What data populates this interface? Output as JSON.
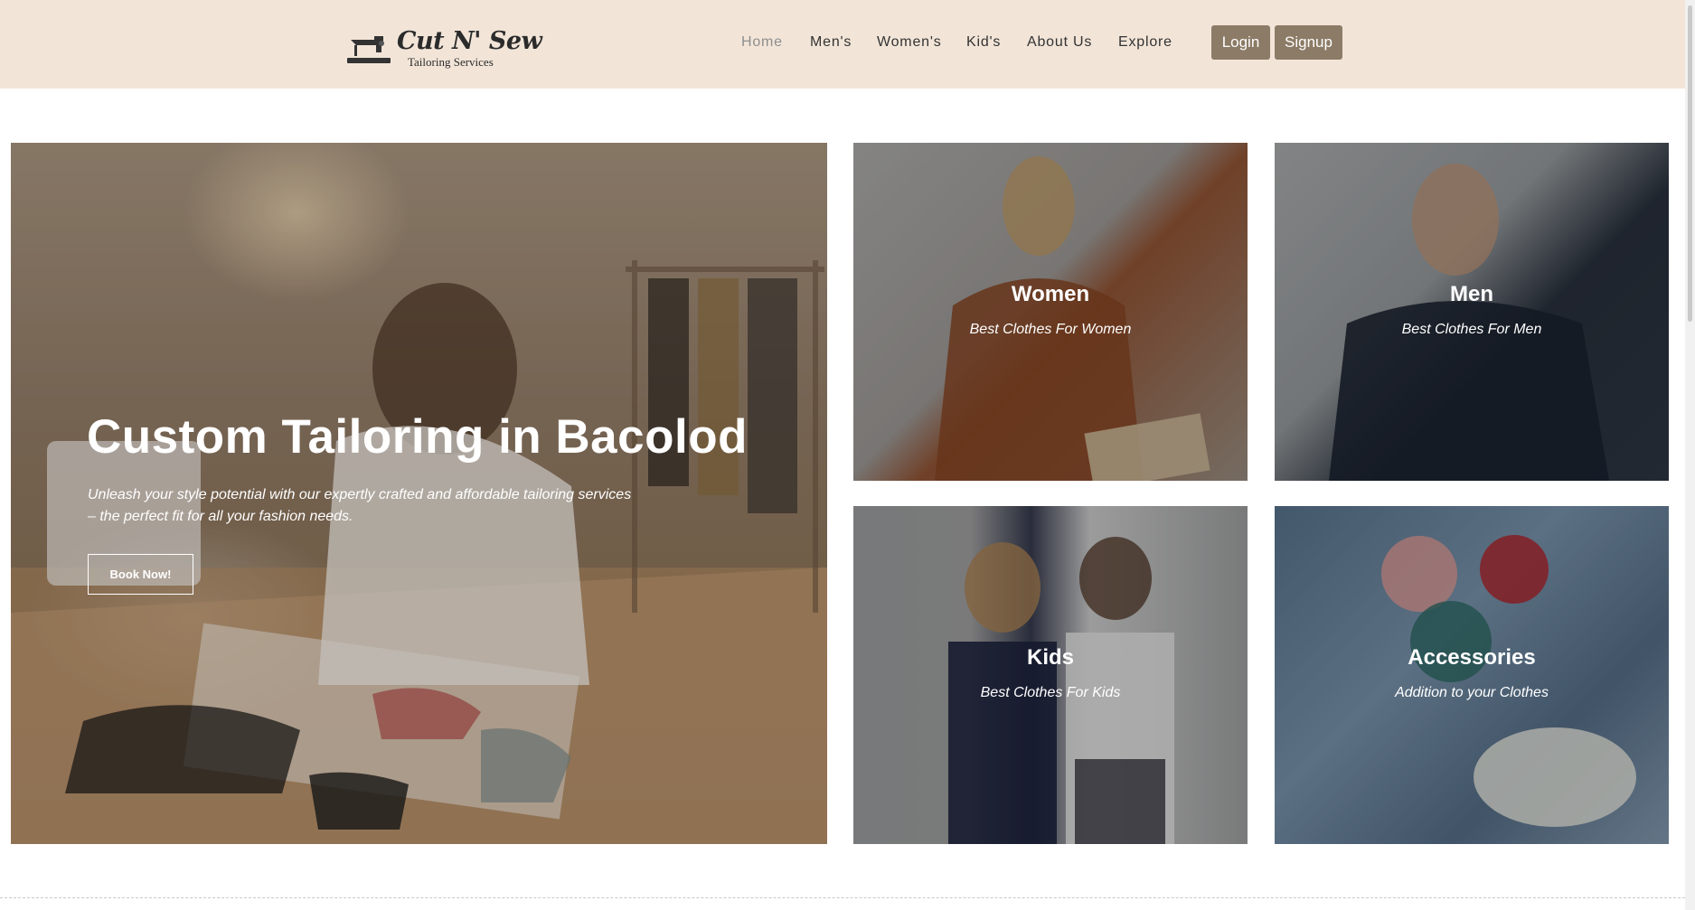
{
  "header": {
    "logo_title": "Cut N' Sew",
    "logo_subtitle": "Tailoring Services",
    "nav": [
      "Home",
      "Men's",
      "Women's",
      "Kid's",
      "About Us",
      "Explore"
    ],
    "active_nav": "Home",
    "login_label": "Login",
    "signup_label": "Signup"
  },
  "hero": {
    "title": "Custom Tailoring in Bacolod",
    "subtitle": "Unleash your style potential with our expertly crafted and affordable tailoring services – the perfect fit for all your fashion needs.",
    "button_label": "Book Now!"
  },
  "categories": [
    {
      "title": "Women",
      "subtitle": "Best Clothes For Women"
    },
    {
      "title": "Men",
      "subtitle": "Best Clothes For Men"
    },
    {
      "title": "Kids",
      "subtitle": "Best Clothes For Kids"
    },
    {
      "title": "Accessories",
      "subtitle": "Addition to your Clothes"
    }
  ],
  "colors": {
    "header_bg": "#f2e5d8",
    "button_bg": "#8c7b66"
  }
}
